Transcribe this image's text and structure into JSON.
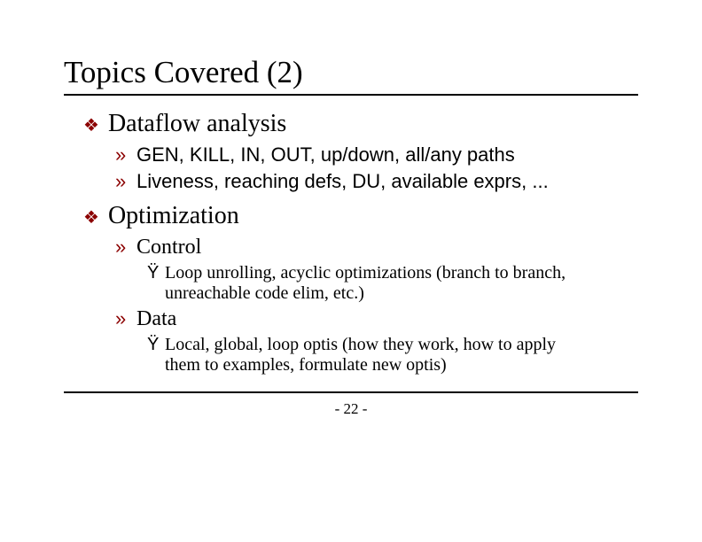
{
  "title": "Topics Covered (2)",
  "bullets": [
    {
      "text": "Dataflow analysis",
      "subs": [
        {
          "text": "GEN, KILL, IN, OUT, up/down, all/any paths",
          "font": "sans"
        },
        {
          "text": "Liveness, reaching defs, DU, available exprs, ...",
          "font": "sans"
        }
      ]
    },
    {
      "text": "Optimization",
      "subs": [
        {
          "text": "Control",
          "font": "serif",
          "subsubs": [
            {
              "text": "Loop unrolling, acyclic optimizations (branch to branch, unreachable code elim, etc.)"
            }
          ]
        },
        {
          "text": "Data",
          "font": "serif",
          "subsubs": [
            {
              "text": "Local, global, loop optis (how they work, how to apply them to examples, formulate new optis)"
            }
          ]
        }
      ]
    }
  ],
  "glyphs": {
    "diamond": "❖",
    "raquo": "»",
    "y": "Ÿ"
  },
  "page": "- 22 -"
}
